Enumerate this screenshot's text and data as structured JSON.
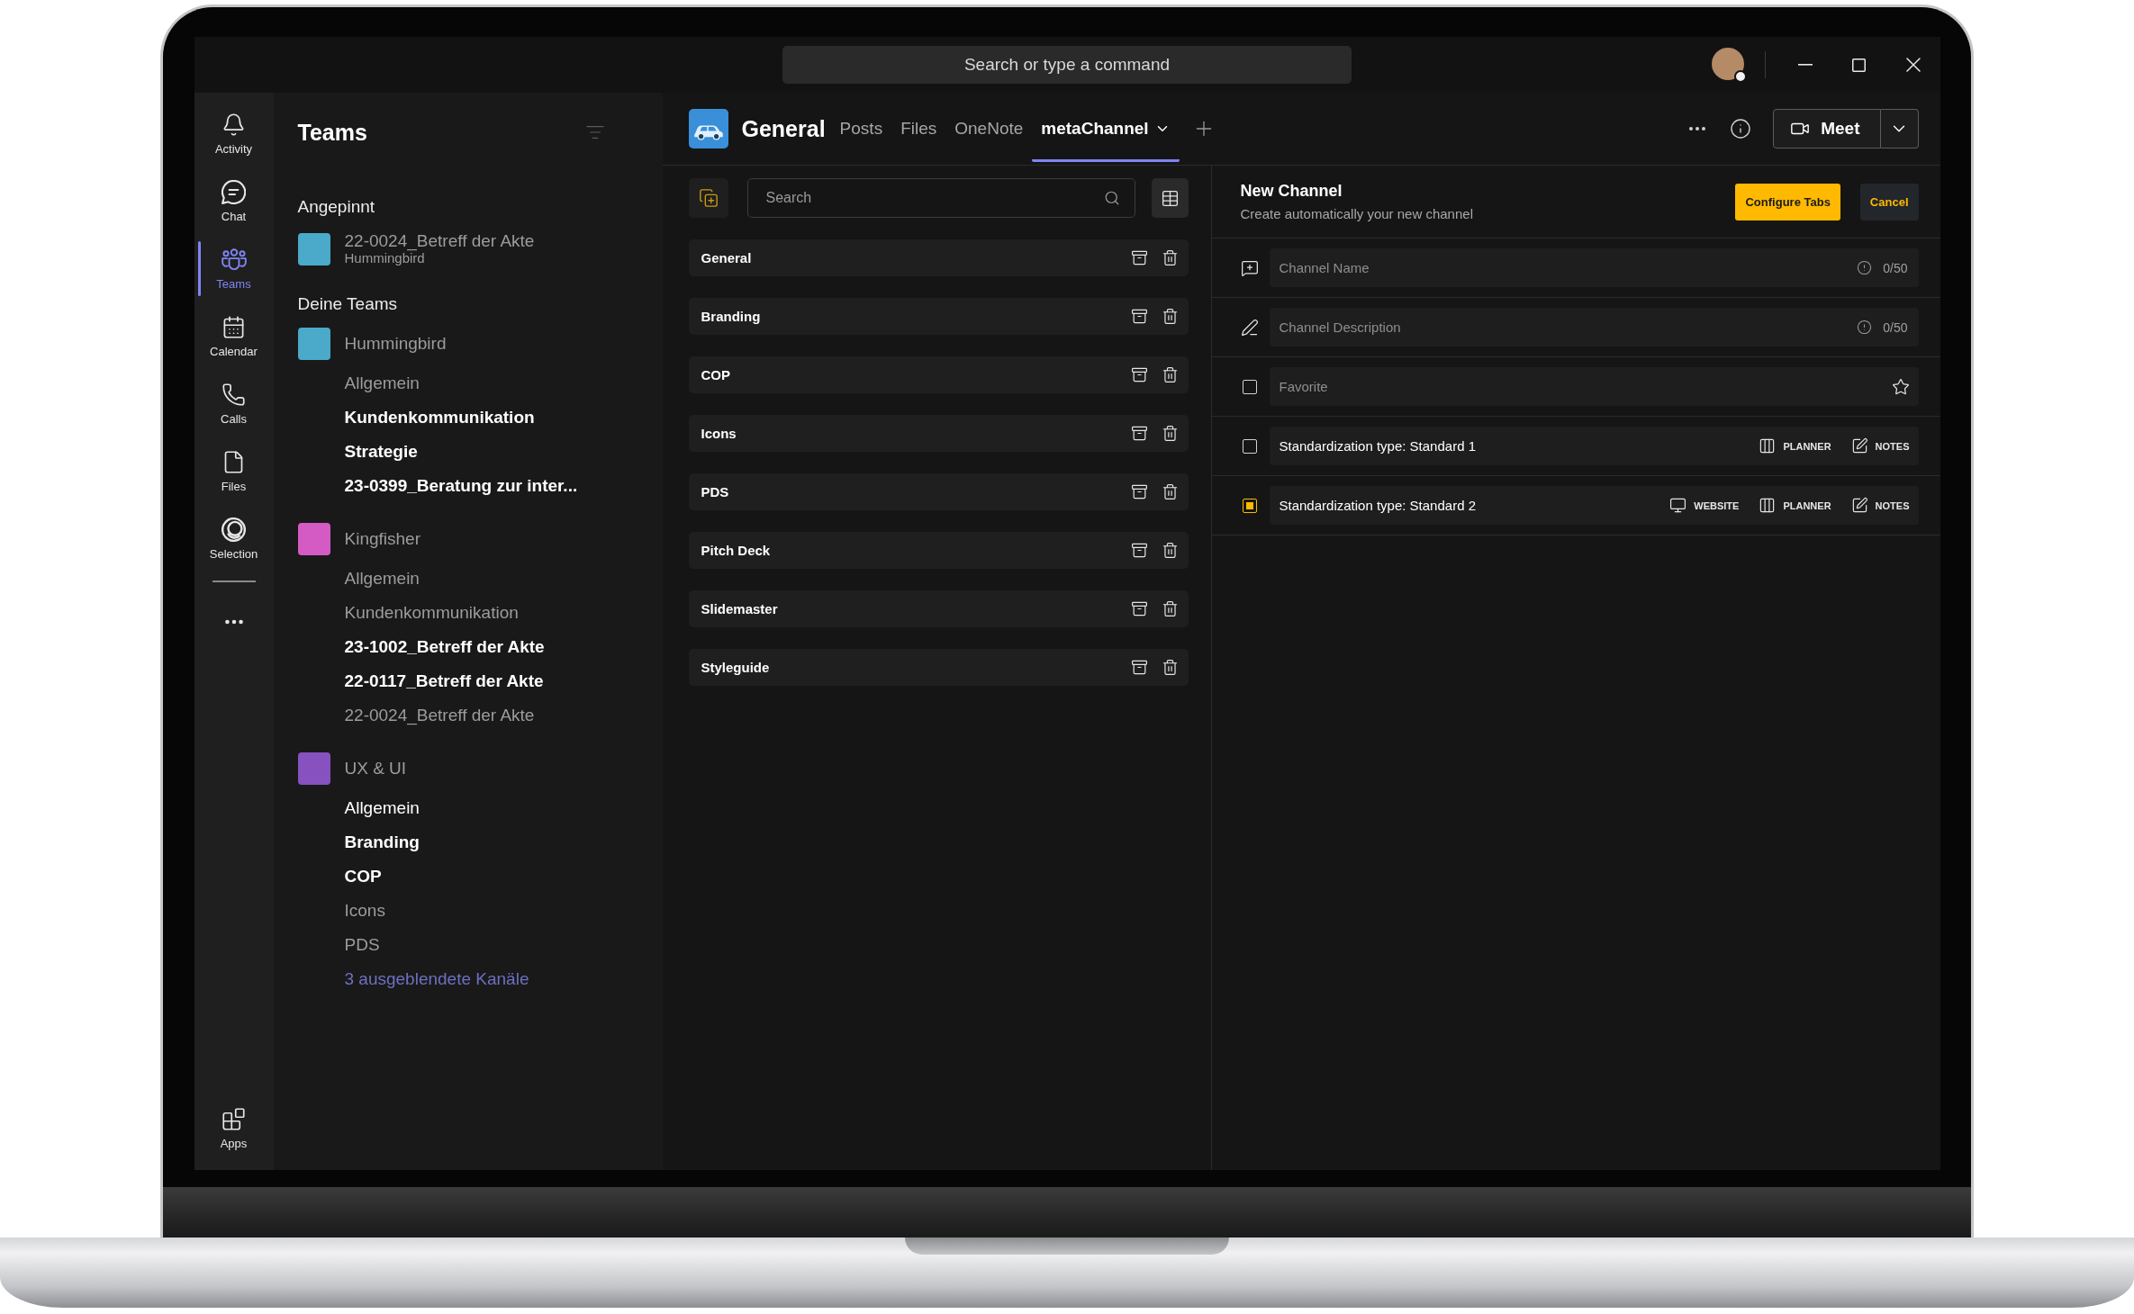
{
  "title_bar": {
    "command_search": {
      "placeholder": "Search or type a command"
    }
  },
  "rail": {
    "items": [
      {
        "label": "Activity",
        "selected": false
      },
      {
        "label": "Chat",
        "selected": false
      },
      {
        "label": "Teams",
        "selected": true
      },
      {
        "label": "Calendar",
        "selected": false
      },
      {
        "label": "Calls",
        "selected": false
      },
      {
        "label": "Files",
        "selected": false
      },
      {
        "label": "Selection",
        "selected": false
      }
    ],
    "apps": {
      "label": "Apps"
    }
  },
  "teams_panel": {
    "title": "Teams",
    "pinned_heading": "Angepinnt",
    "pinned": [
      {
        "name": "22-0024_Betreff der Akte",
        "team": "Hummingbird",
        "color": "#4ba9ca"
      }
    ],
    "teams_heading": "Deine Teams",
    "teams": [
      {
        "name": "Hummingbird",
        "color": "#4ba9ca",
        "channels": [
          {
            "name": "Allgemein",
            "unread": false,
            "dimmed": true
          },
          {
            "name": "Kundenkommunikation",
            "unread": true,
            "dimmed": false
          },
          {
            "name": "Strategie",
            "unread": true,
            "dimmed": false
          },
          {
            "name": "23-0399_Beratung zur inter...",
            "unread": true,
            "dimmed": false
          }
        ]
      },
      {
        "name": "Kingfisher",
        "color": "#d45bc4",
        "channels": [
          {
            "name": "Allgemein",
            "unread": false,
            "dimmed": true
          },
          {
            "name": "Kundenkommunikation",
            "unread": false,
            "dimmed": true
          },
          {
            "name": "23-1002_Betreff der Akte",
            "unread": true,
            "dimmed": false
          },
          {
            "name": "22-0117_Betreff der Akte",
            "unread": true,
            "dimmed": false
          },
          {
            "name": "22-0024_Betreff der Akte",
            "unread": false,
            "dimmed": true
          }
        ]
      },
      {
        "name": "UX & UI",
        "color": "#8751bf",
        "channels": [
          {
            "name": "Allgemein",
            "unread": false,
            "dimmed": false
          },
          {
            "name": "Branding",
            "unread": true,
            "dimmed": false
          },
          {
            "name": "COP",
            "unread": true,
            "dimmed": false
          },
          {
            "name": "Icons",
            "unread": false,
            "dimmed": true
          },
          {
            "name": "PDS",
            "unread": false,
            "dimmed": true
          }
        ],
        "hidden_channels": "3 ausgeblendete Kanäle"
      }
    ]
  },
  "channel_header": {
    "title": "General",
    "tabs": [
      {
        "label": "Posts",
        "selected": false,
        "dropdown": false
      },
      {
        "label": "Files",
        "selected": false,
        "dropdown": false
      },
      {
        "label": "OneNote",
        "selected": false,
        "dropdown": false
      },
      {
        "label": "metaChannel",
        "selected": true,
        "dropdown": true
      }
    ],
    "meet": {
      "label": "Meet"
    }
  },
  "channel_list": {
    "search": {
      "placeholder": "Search"
    },
    "channels": [
      {
        "name": "General"
      },
      {
        "name": "Branding"
      },
      {
        "name": "COP"
      },
      {
        "name": "Icons"
      },
      {
        "name": "PDS"
      },
      {
        "name": "Pitch Deck"
      },
      {
        "name": "Slidemaster"
      },
      {
        "name": "Styleguide"
      }
    ]
  },
  "new_channel": {
    "title": "New Channel",
    "subtitle": "Create automatically your new channel",
    "buttons": [
      {
        "label": "Configure Tabs",
        "kind": "primary"
      },
      {
        "label": "Cancel",
        "kind": "secondary"
      }
    ],
    "fields": [
      {
        "placeholder": "Channel Name",
        "counter": "0/50"
      },
      {
        "placeholder": "Channel Description",
        "counter": "0/50"
      }
    ],
    "options": [
      {
        "kind": "favorite",
        "label": "Favorite",
        "checked": false
      },
      {
        "kind": "standard",
        "label": "Standardization type: Standard 1",
        "checked": false,
        "apps": [
          {
            "kind": "planner",
            "label": "PLANNER"
          },
          {
            "kind": "notes",
            "label": "NOTES"
          }
        ]
      },
      {
        "kind": "standard",
        "label": "Standardization type: Standard 2",
        "checked": true,
        "apps": [
          {
            "kind": "website",
            "label": "WEBSITE"
          },
          {
            "kind": "planner",
            "label": "PLANNER"
          },
          {
            "kind": "notes",
            "label": "NOTES"
          }
        ]
      }
    ]
  }
}
